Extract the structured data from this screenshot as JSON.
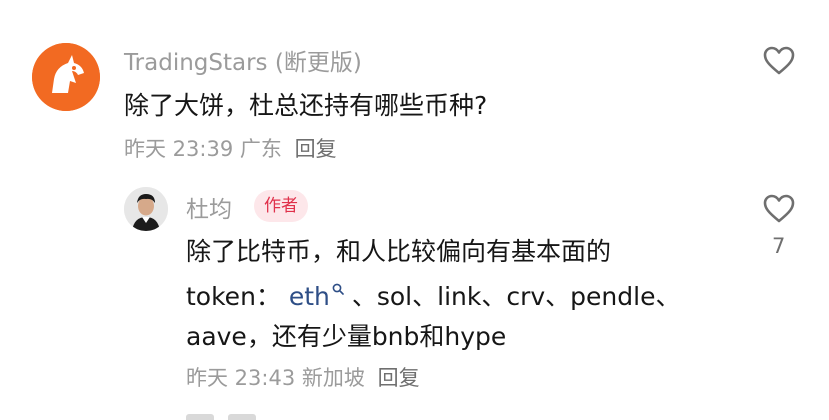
{
  "comments": [
    {
      "username": "TradingStars (断更版)",
      "text": "除了大饼，杜总还持有哪些币种?",
      "time": "昨天 23:39",
      "location": "广东",
      "reply_label": "回复",
      "avatar_icon": "orange-unicorn-avatar",
      "like_icon": "heart-outline-icon"
    }
  ],
  "reply": {
    "username": "杜均",
    "badge": "作者",
    "line1": "除了比特币，和人比较偏向有基本面的",
    "line2_prefix": "token：",
    "line2_link": "eth",
    "line2_suffix": "、sol、link、crv、pendle、",
    "line3": "aave，还有少量bnb和hype",
    "time": "昨天 23:43",
    "location": "新加坡",
    "reply_label": "回复",
    "like_count": "7",
    "avatar_icon": "profile-photo-avatar",
    "like_icon": "heart-outline-icon",
    "search_icon": "search-icon"
  },
  "colors": {
    "muted_text": "#9b9b9b",
    "body_text": "#161616",
    "author_badge_bg": "#fde7ea",
    "author_badge_text": "#e0314b",
    "link": "#2e4e86",
    "avatar_orange": "#f26a22"
  }
}
